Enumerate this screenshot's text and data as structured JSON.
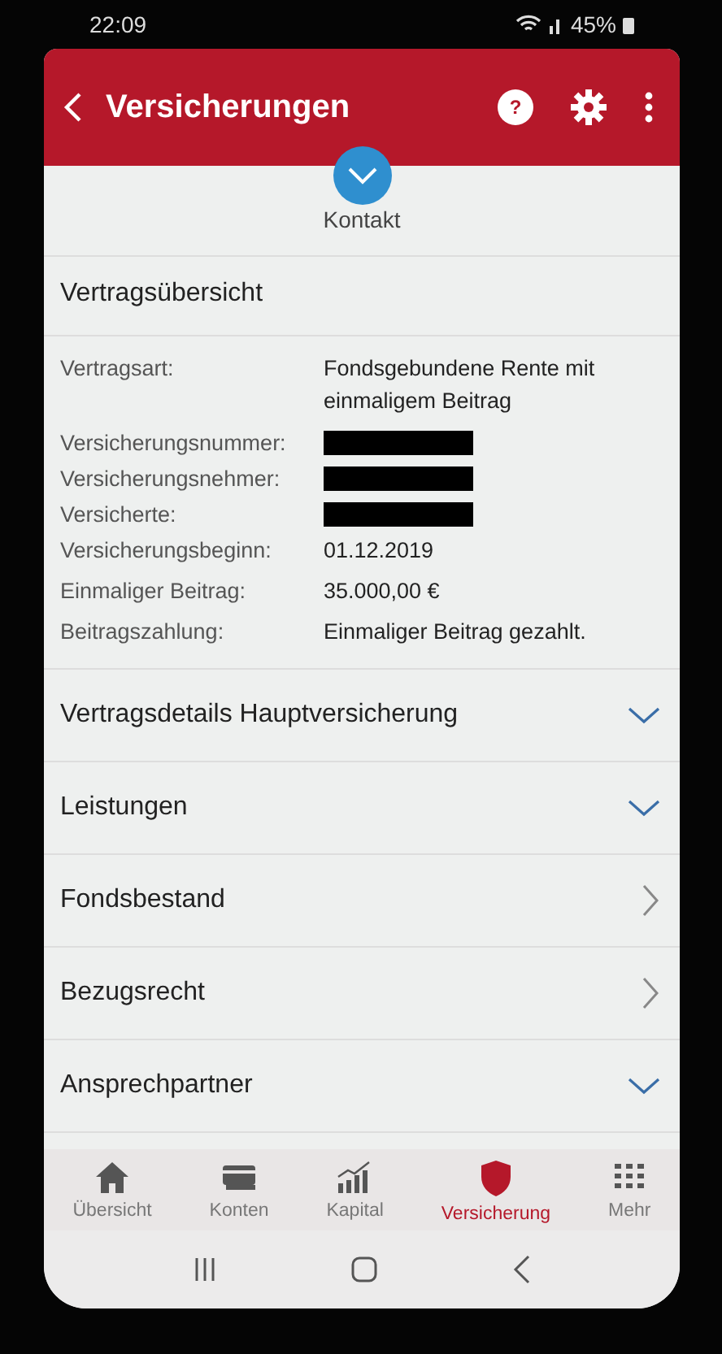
{
  "status_bar": {
    "time": "22:09",
    "battery": "45%"
  },
  "header": {
    "title": "Versicherungen",
    "help": "?"
  },
  "contact": {
    "label": "Kontakt"
  },
  "overview": {
    "title": "Vertragsübersicht",
    "rows": [
      {
        "label": "Vertragsart:",
        "value": "Fondsgebundene Rente mit einmaligem Beitrag",
        "redacted": false
      },
      {
        "label": "Versicherungsnummer:",
        "redacted": true
      },
      {
        "label": "Versicherungsnehmer:",
        "redacted": true
      },
      {
        "label": "Versicherte:",
        "redacted": true
      },
      {
        "label": "Versicherungsbeginn:",
        "value": "01.12.2019",
        "redacted": false
      },
      {
        "label": "Einmaliger Beitrag:",
        "value": "35.000,00 €",
        "redacted": false
      },
      {
        "label": "Beitragszahlung:",
        "value": "Einmaliger Beitrag gezahlt.",
        "redacted": false
      }
    ]
  },
  "sections": [
    {
      "title": "Vertragsdetails Hauptversicherung",
      "kind": "accordion"
    },
    {
      "title": "Leistungen",
      "kind": "accordion"
    },
    {
      "title": "Fondsbestand",
      "kind": "link"
    },
    {
      "title": "Bezugsrecht",
      "kind": "link"
    },
    {
      "title": "Ansprechpartner",
      "kind": "accordion"
    }
  ],
  "tab_bar": [
    {
      "label": "Übersicht",
      "selected": false
    },
    {
      "label": "Konten",
      "selected": false
    },
    {
      "label": "Kapital",
      "selected": false
    },
    {
      "label": "Versicherung",
      "selected": true
    },
    {
      "label": "Mehr",
      "selected": false
    }
  ]
}
